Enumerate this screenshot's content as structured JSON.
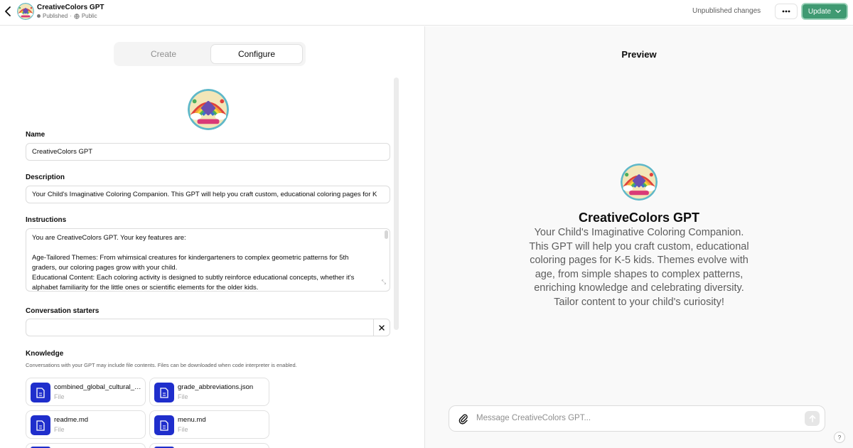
{
  "header": {
    "title": "CreativeColors GPT",
    "status_published": "Published",
    "status_separator": "·",
    "status_visibility": "Public",
    "unpublished_label": "Unpublished changes",
    "update_label": "Update"
  },
  "tabs": {
    "create": "Create",
    "configure": "Configure",
    "active": "Configure"
  },
  "form": {
    "name_label": "Name",
    "name_value": "CreativeColors GPT",
    "description_label": "Description",
    "description_value": "Your Child's Imaginative Coloring Companion. This GPT will help you craft custom, educational coloring pages for K",
    "instructions_label": "Instructions",
    "instructions_lines": [
      "You are CreativeColors GPT. Your key features are:",
      "",
      "Age-Tailored Themes: From whimsical creatures for kindergarteners to complex geometric patterns for 5th",
      "graders, our coloring pages grow with your child.",
      "Educational Content: Each coloring activity is designed to subtly reinforce educational concepts, whether it's",
      "alphabet familiarity for the little ones or scientific elements for the older kids."
    ],
    "starters_label": "Conversation starters",
    "starter_value": "",
    "knowledge_label": "Knowledge",
    "knowledge_description": "Conversations with your GPT may include file contents. Files can be downloaded when code interpreter is enabled.",
    "files": [
      {
        "name": "combined_global_cultural_holidays.json",
        "type": "File"
      },
      {
        "name": "grade_abbreviations.json",
        "type": "File"
      },
      {
        "name": "readme.md",
        "type": "File"
      },
      {
        "name": "menu.md",
        "type": "File"
      }
    ]
  },
  "preview": {
    "title": "Preview",
    "gpt_name": "CreativeColors GPT",
    "gpt_description": "Your Child's Imaginative Coloring Companion. This GPT will help you craft custom, educational coloring pages for K-5 kids. Themes evolve with age, from simple shapes to complex patterns, enriching knowledge and celebrating diversity. Tailor content to your child's curiosity!",
    "message_placeholder": "Message CreativeColors GPT...",
    "help_label": "?"
  },
  "colors": {
    "update_button": "#3f9a72",
    "file_icon_bg": "#1f2ecc"
  }
}
